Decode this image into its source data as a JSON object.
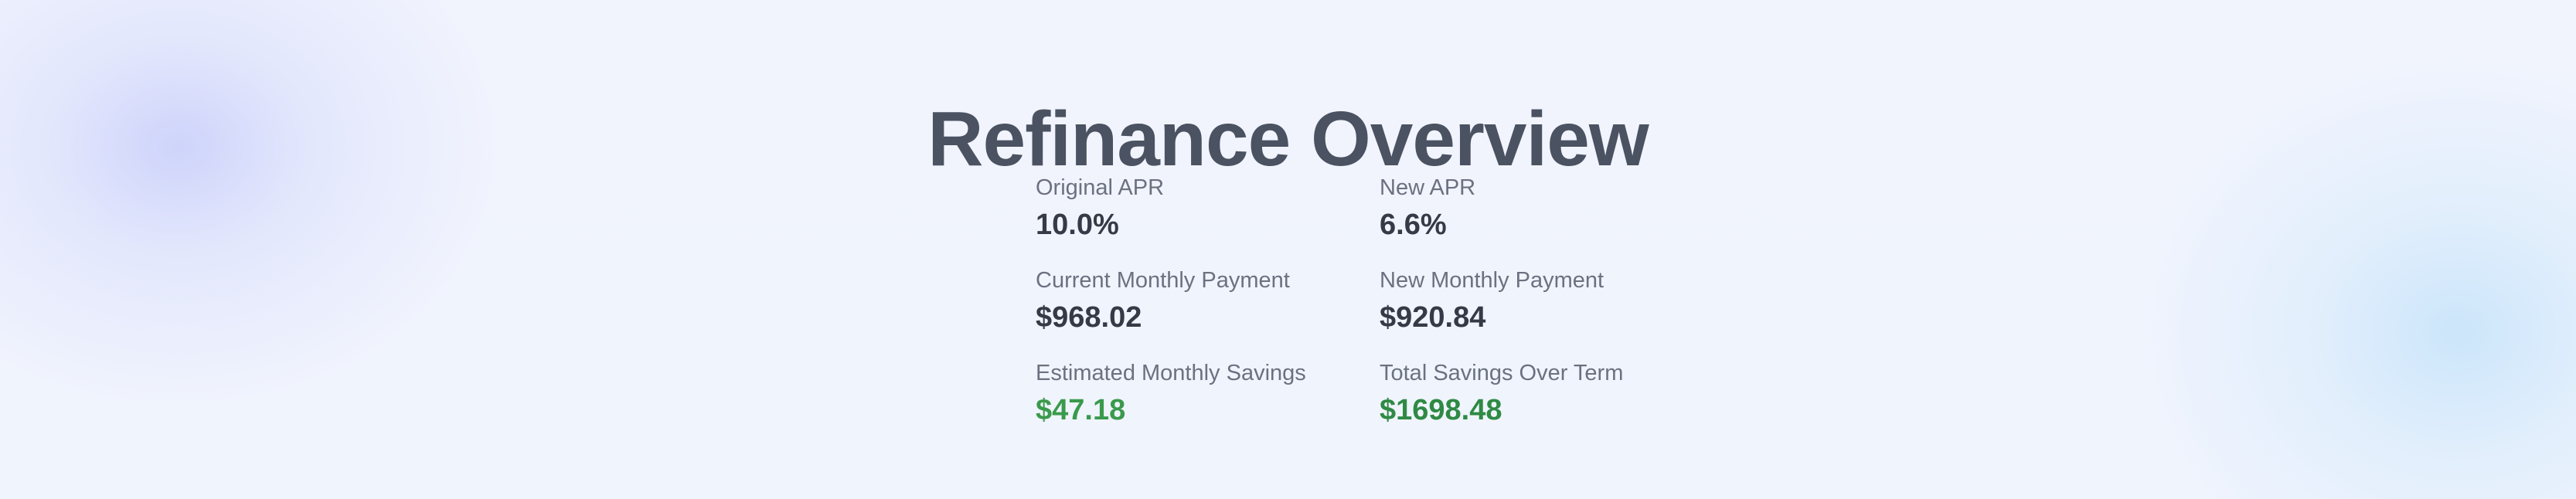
{
  "page": {
    "title": "Refinance Overview"
  },
  "stats": [
    {
      "label": "Original APR",
      "value": "10.0%"
    },
    {
      "label": "New APR",
      "value": "6.6%"
    },
    {
      "label": "Current Monthly Payment",
      "value": "$968.02"
    },
    {
      "label": "New Monthly Payment",
      "value": "$920.84"
    },
    {
      "label": "Estimated Monthly Savings",
      "value": "$47.18"
    },
    {
      "label": "Total Savings Over Term",
      "value": "$1698.48"
    }
  ],
  "colors": {
    "title": "#4b5261",
    "label": "#6b7180",
    "value": "#343a46",
    "savings": "#3a9a4c",
    "total_savings": "#2f8a44"
  }
}
